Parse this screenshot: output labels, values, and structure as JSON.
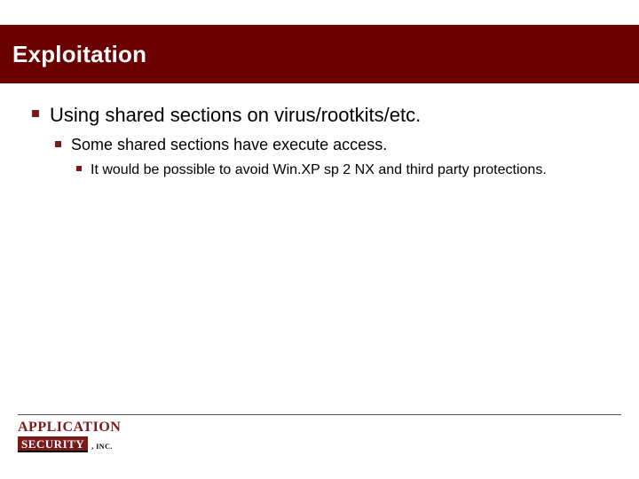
{
  "title": "Exploitation",
  "bullets": {
    "lvl1": "Using shared sections on virus/rootkits/etc.",
    "lvl2": "Some shared sections have execute access.",
    "lvl3": "It would be possible to avoid Win.XP sp 2 NX and third party protections."
  },
  "logo": {
    "top": "APPLICATION",
    "security": "SECURITY",
    "inc": ", INC."
  }
}
